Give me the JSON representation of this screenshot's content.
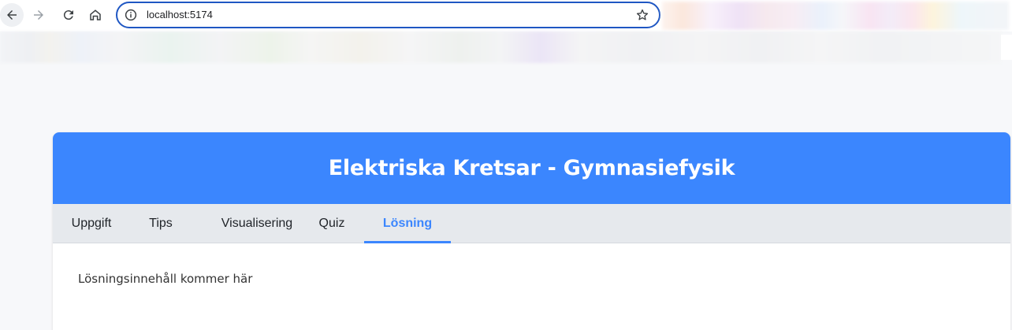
{
  "browser": {
    "url": "localhost:5174",
    "icons": {
      "back": "arrow-left-icon",
      "forward": "arrow-right-icon",
      "reload": "reload-icon",
      "home": "home-icon",
      "info": "info-icon",
      "bookmark": "star-icon"
    }
  },
  "app": {
    "title": "Elektriska Kretsar - Gymnasiefysik",
    "accent_color": "#3b86fe",
    "tabs": [
      {
        "label": "Uppgift",
        "active": false
      },
      {
        "label": "Tips",
        "active": false
      },
      {
        "label": "Visualisering",
        "active": false
      },
      {
        "label": "Quiz",
        "active": false
      },
      {
        "label": "Lösning",
        "active": true
      }
    ],
    "content_text": "Lösningsinnehåll kommer här"
  }
}
